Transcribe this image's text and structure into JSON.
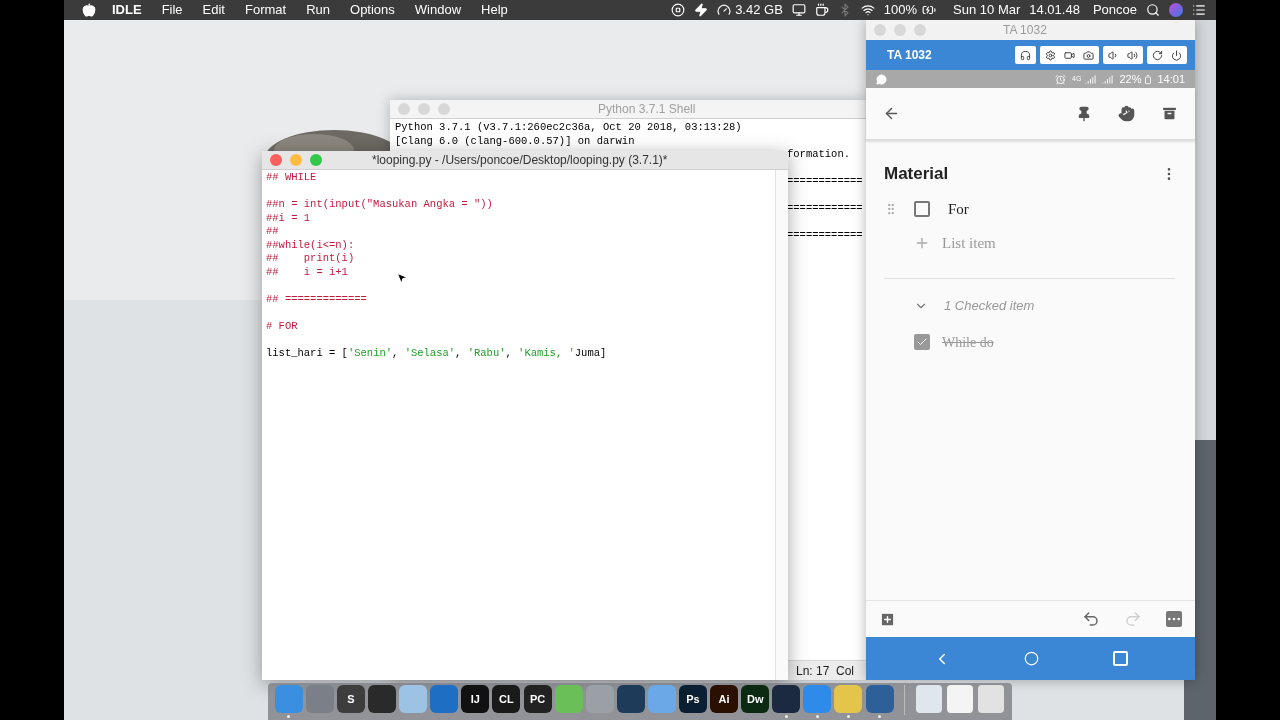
{
  "menubar": {
    "app": "IDLE",
    "menus": [
      "File",
      "Edit",
      "Format",
      "Run",
      "Options",
      "Window",
      "Help"
    ],
    "memory": "3.42 GB",
    "battery": "100%",
    "date": "Sun 10 Mar",
    "time": "14.01.48",
    "user": "Poncoe"
  },
  "shell": {
    "title": "Python 3.7.1 Shell",
    "active": false,
    "lines": [
      {
        "kind": "full",
        "text": "Python 3.7.1 (v3.7.1:260ec2c36a, Oct 20 2018, 03:13:28)"
      },
      {
        "kind": "full",
        "text": "[Clang 6.0 (clang-600.0.57)] on darwin"
      },
      {
        "kind": "partial",
        "text": "formation."
      },
      {
        "kind": "blank"
      },
      {
        "kind": "partial",
        "text": "============"
      },
      {
        "kind": "blank"
      },
      {
        "kind": "partial",
        "text": "============"
      },
      {
        "kind": "blank"
      },
      {
        "kind": "partial",
        "text": "============"
      }
    ],
    "status": "Ln: 17  Col"
  },
  "editor": {
    "title": "*looping.py - /Users/poncoe/Desktop/looping.py (3.7.1)*",
    "active": true,
    "lines": [
      {
        "kind": "code",
        "segments": [
          {
            "kind": "comment",
            "text": "## WHILE"
          }
        ]
      },
      {
        "kind": "blank"
      },
      {
        "kind": "code",
        "segments": [
          {
            "kind": "comment",
            "text": "##n = int(input(\"Masukan Angka = \"))"
          }
        ]
      },
      {
        "kind": "code",
        "segments": [
          {
            "kind": "comment",
            "text": "##i = 1"
          }
        ]
      },
      {
        "kind": "code",
        "segments": [
          {
            "kind": "comment",
            "text": "##"
          }
        ]
      },
      {
        "kind": "code",
        "segments": [
          {
            "kind": "comment",
            "text": "##while(i<=n):"
          }
        ]
      },
      {
        "kind": "code",
        "segments": [
          {
            "kind": "comment",
            "text": "##    print(i)"
          }
        ]
      },
      {
        "kind": "code",
        "segments": [
          {
            "kind": "comment",
            "text": "##    i = i+1"
          }
        ]
      },
      {
        "kind": "blank"
      },
      {
        "kind": "code",
        "segments": [
          {
            "kind": "comment",
            "text": "## ============="
          }
        ]
      },
      {
        "kind": "blank"
      },
      {
        "kind": "code",
        "segments": [
          {
            "kind": "comment",
            "text": "# FOR"
          }
        ]
      },
      {
        "kind": "blank"
      },
      {
        "kind": "code",
        "segments": [
          {
            "kind": "plain",
            "text": "list_hari = ["
          },
          {
            "kind": "string",
            "text": "'Senin'"
          },
          {
            "kind": "plain",
            "text": ", "
          },
          {
            "kind": "string",
            "text": "'Selasa'"
          },
          {
            "kind": "plain",
            "text": ", "
          },
          {
            "kind": "string",
            "text": "'Rabu'"
          },
          {
            "kind": "plain",
            "text": ", "
          },
          {
            "kind": "string",
            "text": "'Kamis, '"
          },
          {
            "kind": "plain",
            "text": "Juma]"
          }
        ]
      }
    ]
  },
  "phone": {
    "window_title": "TA 1032",
    "device": "TA 1032",
    "active": false,
    "network": "4G",
    "battery": "22%",
    "clock": "14:01",
    "note_title": "Material",
    "items": [
      {
        "text": "For",
        "checked": false
      }
    ],
    "add_placeholder": "List item",
    "checked_header": {
      "text": "1 Checked item",
      "expanded": true
    },
    "checked_items": [
      {
        "text": "While do",
        "checked": true
      }
    ],
    "redo_disabled": true
  },
  "dock": [
    {
      "color": "#3b8fe0",
      "running": true
    },
    {
      "color": "#7b8088",
      "running": false
    },
    {
      "color": "#3d3d3d",
      "label": "S",
      "running": false
    },
    {
      "color": "#2a2a2a",
      "running": false
    },
    {
      "color": "#9cc3e4",
      "running": false
    },
    {
      "color": "#1e6fc4",
      "running": false
    },
    {
      "color": "#111111",
      "label": "IJ",
      "running": false
    },
    {
      "color": "#1a1a1a",
      "label": "CL",
      "running": false
    },
    {
      "color": "#222222",
      "label": "PC",
      "running": false
    },
    {
      "color": "#6bbf59",
      "running": false
    },
    {
      "color": "#9aa0a6",
      "running": false
    },
    {
      "color": "#1f3b5a",
      "running": false
    },
    {
      "color": "#6aa8e8",
      "running": false
    },
    {
      "color": "#0b1f33",
      "label": "Ps",
      "running": false
    },
    {
      "color": "#2b0f00",
      "label": "Ai",
      "running": false
    },
    {
      "color": "#0a2b12",
      "label": "Dw",
      "running": false
    },
    {
      "color": "#1b2a40",
      "running": true
    },
    {
      "color": "#2f8bea",
      "running": true
    },
    {
      "color": "#e4c44a",
      "running": true
    },
    {
      "color": "#2d5f99",
      "running": true
    }
  ],
  "dock_extra": [
    {
      "color": "#dfe6ee"
    },
    {
      "color": "#f4f4f4"
    },
    {
      "color": "#e2e2e2"
    }
  ]
}
